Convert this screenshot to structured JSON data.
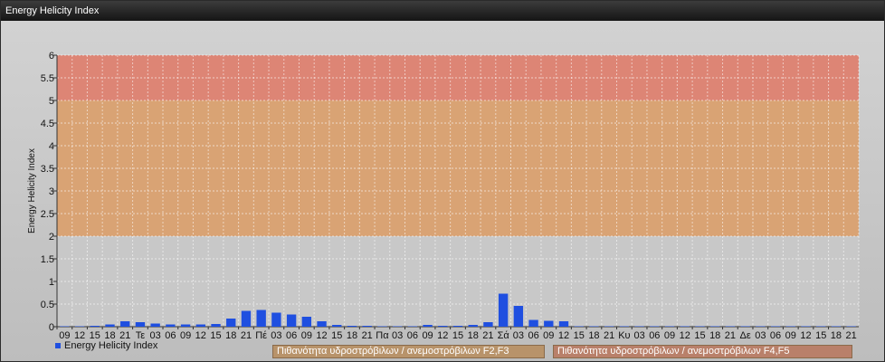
{
  "window": {
    "title": "Energy Helicity Index"
  },
  "colors": {
    "bar": "#1f4fe0",
    "zone_high": "#dd8575",
    "zone_mid": "#d9a374",
    "grid": "#ffffff"
  },
  "chart_data": {
    "type": "bar",
    "title": "",
    "ylabel": "Energy Helicity Index",
    "xlabel": "",
    "ylim": [
      0,
      6
    ],
    "yticks": [
      "0",
      "0.5",
      "1",
      "1.5",
      "2",
      "2.5",
      "3",
      "3.5",
      "4",
      "4.5",
      "5",
      "5.5",
      "6"
    ],
    "grid": true,
    "bands": [
      {
        "from": 2,
        "to": 5,
        "label": "Πιθανότητα υδροστρόβιλων / ανεμοστρόβιλων F2,F3",
        "color": "#d9a374"
      },
      {
        "from": 5,
        "to": 6,
        "label": "Πιθανότητα υδροστρόβιλων / ανεμοστρόβιλων F4,F5",
        "color": "#dd8575"
      }
    ],
    "categories": [
      "09",
      "12",
      "15",
      "18",
      "21",
      "Τε",
      "03",
      "06",
      "09",
      "12",
      "15",
      "18",
      "21",
      "Πέ",
      "03",
      "06",
      "09",
      "12",
      "15",
      "18",
      "21",
      "Πα",
      "03",
      "06",
      "09",
      "12",
      "15",
      "18",
      "21",
      "Σά",
      "03",
      "06",
      "09",
      "12",
      "15",
      "18",
      "21",
      "Κυ",
      "03",
      "06",
      "09",
      "12",
      "15",
      "18",
      "21",
      "Δε",
      "03",
      "06",
      "09",
      "12",
      "15",
      "18",
      "21"
    ],
    "series": [
      {
        "name": "Energy Helicity Index",
        "values": [
          0.01,
          0.01,
          0.02,
          0.05,
          0.12,
          0.1,
          0.07,
          0.05,
          0.05,
          0.05,
          0.06,
          0.18,
          0.35,
          0.37,
          0.31,
          0.27,
          0.22,
          0.12,
          0.04,
          0.02,
          0.02,
          0.01,
          0.01,
          0.01,
          0.04,
          0.02,
          0.02,
          0.04,
          0.1,
          0.73,
          0.46,
          0.15,
          0.13,
          0.12,
          0.01,
          0.01,
          0.01,
          0.01,
          0.01,
          0.01,
          0.01,
          0.01,
          0.01,
          0.01,
          0.01,
          0.01,
          0.01,
          0.01,
          0.01,
          0.01,
          0.01,
          0.01,
          0.01
        ]
      }
    ],
    "legend": "bottom-left"
  }
}
